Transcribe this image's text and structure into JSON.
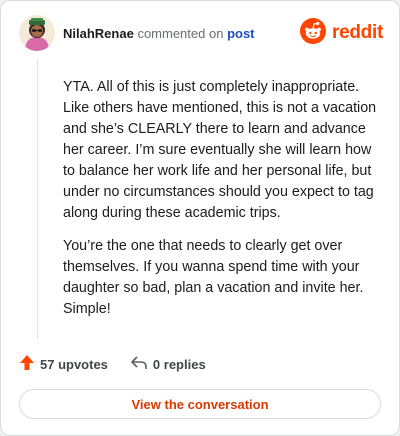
{
  "header": {
    "username": "NilahRenae",
    "action_text": "commented on",
    "target_text": "post",
    "brand": "reddit",
    "brand_color": "#ff4500"
  },
  "comment": {
    "paragraphs": [
      "YTA. All of this is just completely inappropriate. Like others have mentioned, this is not a vacation and she’s CLEARLY there to learn and advance her career. I’m sure eventually she will learn how to balance her work life and her personal life, but under no circumstances should you expect to tag along during these academic trips.",
      "You’re the one that needs to clearly get over themselves. If you wanna spend time with your daughter so bad, plan a vacation and invite her. Simple!"
    ]
  },
  "stats": {
    "upvotes_label": "57 upvotes",
    "upvote_icon": "upvote-arrow-icon",
    "replies_label": "0 replies",
    "reply_icon": "reply-arrow-icon"
  },
  "cta": {
    "label": "View the conversation"
  },
  "icons": {
    "avatar": "avatar",
    "brand": "reddit-snoo-icon"
  }
}
